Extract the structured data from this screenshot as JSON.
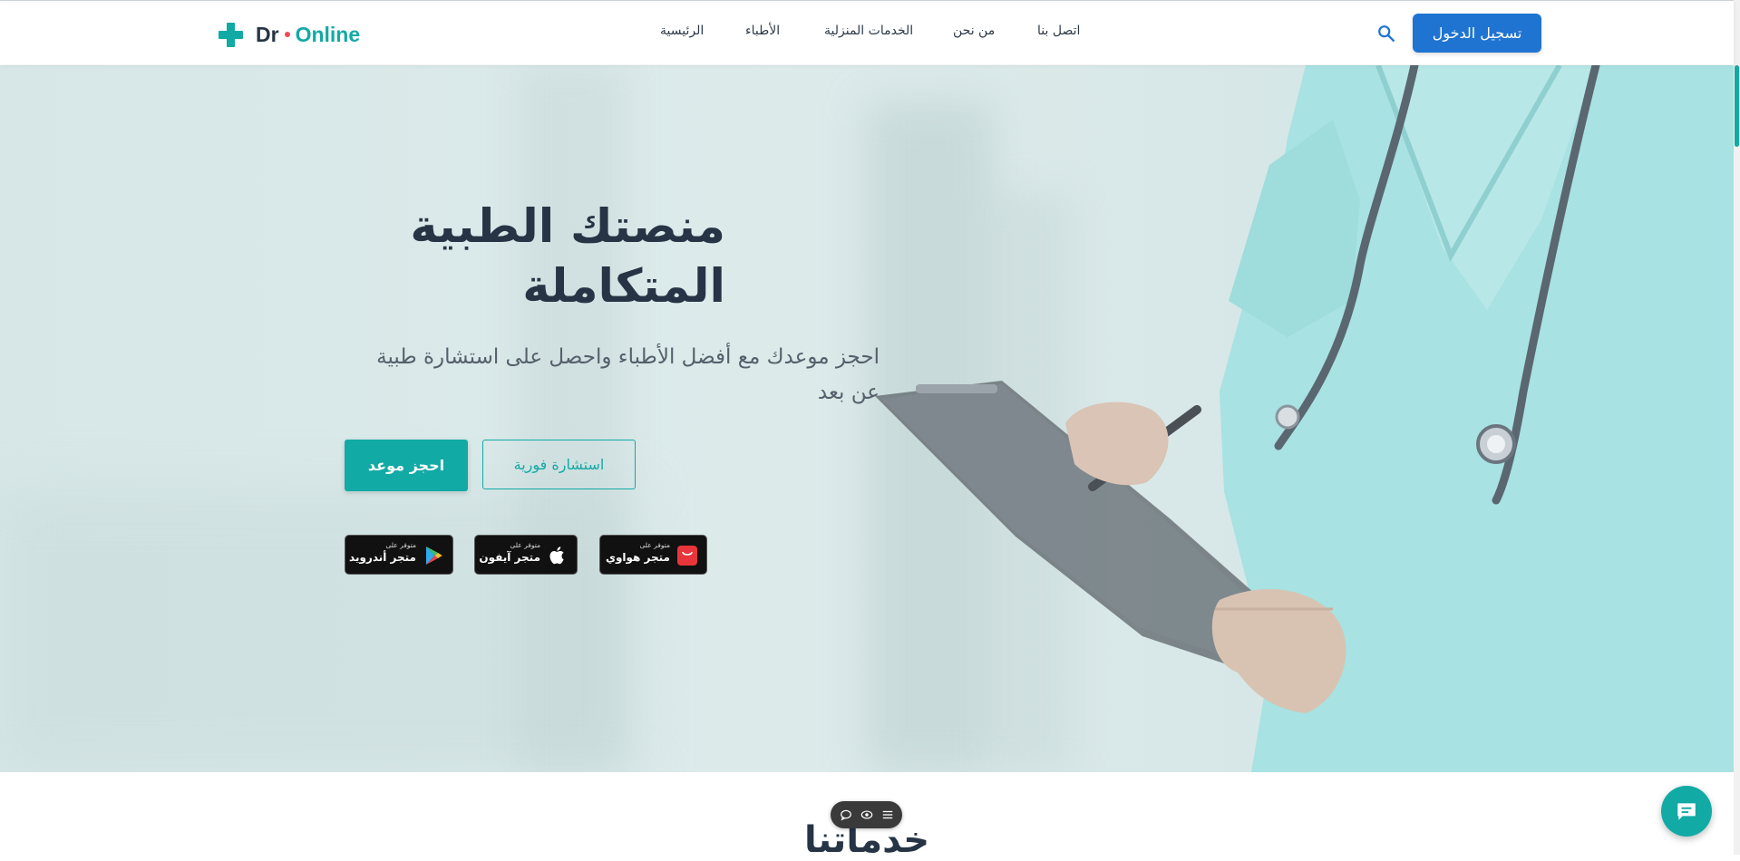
{
  "header": {
    "logo": {
      "dr": "Dr",
      "online": "Online"
    },
    "nav": [
      "اتصل بنا",
      "من نحن",
      "الخدمات المنزلية",
      "الأطباء",
      "الرئيسية"
    ],
    "search_icon": "search-icon",
    "login_label": "تسجيل الدخول"
  },
  "hero": {
    "title": "منصتك الطبية المتكاملة",
    "subtitle": "احجز موعدك مع أفضل الأطباء واحصل على استشارة طبية عن بعد",
    "book_label": "احجز موعد",
    "consult_label": "استشارة فورية",
    "stores": [
      {
        "small": "متوفر على",
        "name": "متجر هواوي",
        "icon": "huawei-appgallery-icon"
      },
      {
        "small": "متوفر على",
        "name": "متجر آيفون",
        "icon": "apple-icon"
      },
      {
        "small": "متوفر على",
        "name": "متجر أندرويد",
        "icon": "google-play-icon"
      }
    ]
  },
  "services": {
    "title": "خدماتنا"
  },
  "colors": {
    "primary": "#12aaa5",
    "login_button": "#1f74d2",
    "text_dark": "#263445"
  }
}
